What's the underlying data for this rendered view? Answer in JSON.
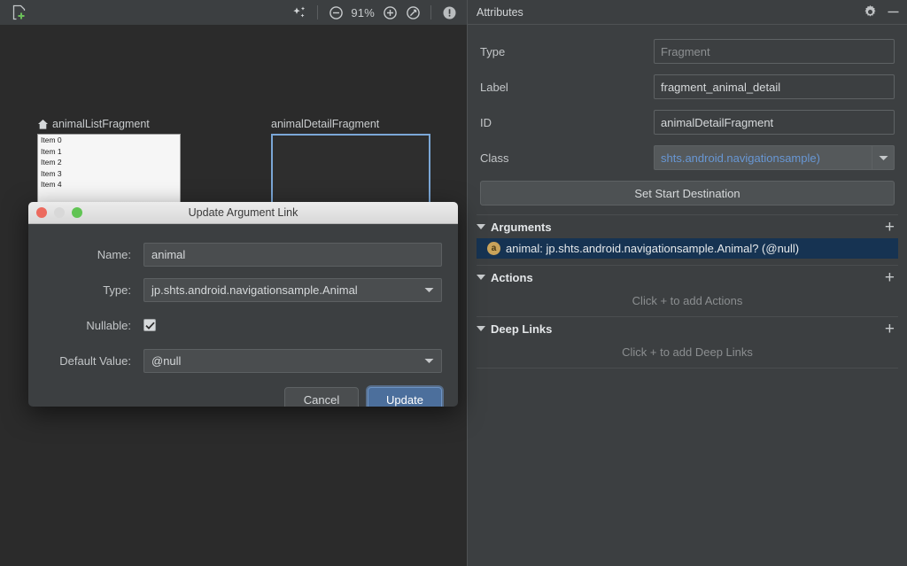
{
  "design_toolbar": {
    "new_destination_icon": "new-destination-icon",
    "auto_arrange_icon": "auto-arrange-icon",
    "zoom_out_icon": "zoom-out-icon",
    "zoom_level": "91%",
    "zoom_in_icon": "zoom-in-icon",
    "zoom_fit_icon": "zoom-to-fit-icon",
    "issues_icon": "issues-info-icon"
  },
  "canvas": {
    "nodes": [
      {
        "title": "animalListFragment",
        "is_start_destination": true,
        "start_icon": "home-icon",
        "selected": false,
        "preview_items": [
          "Item 0",
          "Item 1",
          "Item 2",
          "Item 3",
          "Item 4"
        ]
      },
      {
        "title": "animalDetailFragment",
        "is_start_destination": false,
        "selected": true,
        "preview_items": []
      }
    ]
  },
  "attributes_panel": {
    "title": "Attributes",
    "settings_icon": "gear-icon",
    "minimize_icon": "minimize-icon",
    "fields": [
      {
        "label": "Type",
        "value": "Fragment",
        "kind": "readonly"
      },
      {
        "label": "Label",
        "value": "fragment_animal_detail",
        "kind": "text"
      },
      {
        "label": "ID",
        "value": "animalDetailFragment",
        "kind": "text"
      },
      {
        "label": "Class",
        "value": "shts.android.navigationsample)",
        "kind": "combo"
      }
    ],
    "set_start_destination_label": "Set Start Destination",
    "sections": [
      {
        "title": "Arguments",
        "add_icon": "plus-icon",
        "collapse_icon": "triangle-down-icon",
        "items": [
          {
            "badge": "a",
            "text": "animal: jp.shts.android.navigationsample.Animal?  (@null)",
            "selected": true
          }
        ],
        "empty_text": ""
      },
      {
        "title": "Actions",
        "add_icon": "plus-icon",
        "collapse_icon": "triangle-down-icon",
        "items": [],
        "empty_text": "Click + to add Actions"
      },
      {
        "title": "Deep Links",
        "add_icon": "plus-icon",
        "collapse_icon": "triangle-down-icon",
        "items": [],
        "empty_text": "Click + to add Deep Links"
      }
    ]
  },
  "dialog": {
    "title": "Update Argument Link",
    "close_icon": "close-traffic-light",
    "minimize_icon": "minimize-traffic-light",
    "maximize_icon": "maximize-traffic-light",
    "name_label": "Name:",
    "name_value": "animal",
    "type_label": "Type:",
    "type_value": "jp.shts.android.navigationsample.Animal",
    "nullable_label": "Nullable:",
    "nullable_checked": true,
    "default_value_label": "Default Value:",
    "default_value": "@null",
    "cancel_label": "Cancel",
    "update_label": "Update"
  },
  "colors": {
    "canvas_bg": "#2b2b2b",
    "panel_bg": "#3c3f41",
    "accent_blue": "#6897d4",
    "selection_blue": "#7ba7d7",
    "arg_row_bg": "#163352",
    "arg_badge": "#c9a35a",
    "primary_button": "#4c6f9c"
  }
}
